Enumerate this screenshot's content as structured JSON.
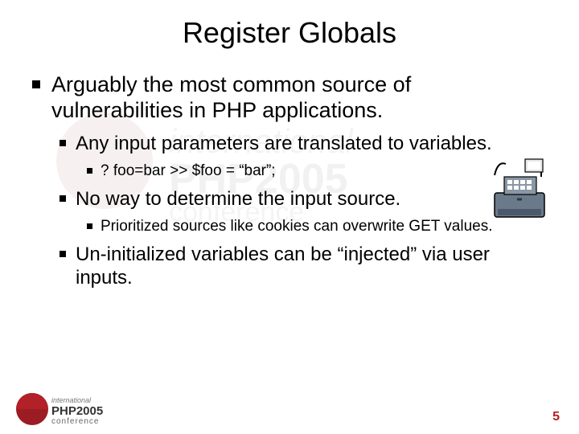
{
  "title": "Register Globals",
  "bullets": {
    "l1": [
      {
        "text": "Arguably the most common source of vulnerabilities in PHP applications."
      }
    ],
    "l2a": {
      "text": "Any input parameters are translated to variables."
    },
    "l3a": {
      "text": "? foo=bar  >>  $foo = “bar”;"
    },
    "l2b": {
      "text": "No way to determine the input source."
    },
    "l3b": {
      "text": "Prioritized sources like cookies can overwrite GET values."
    },
    "l2c": {
      "text": "Un-initialized variables can be “injected” via user inputs."
    }
  },
  "footer": {
    "logo_top": "international",
    "logo_mid": "PHP2005",
    "logo_bot": "conference"
  },
  "page_number": "5",
  "clipart_name": "cash-register-icon"
}
